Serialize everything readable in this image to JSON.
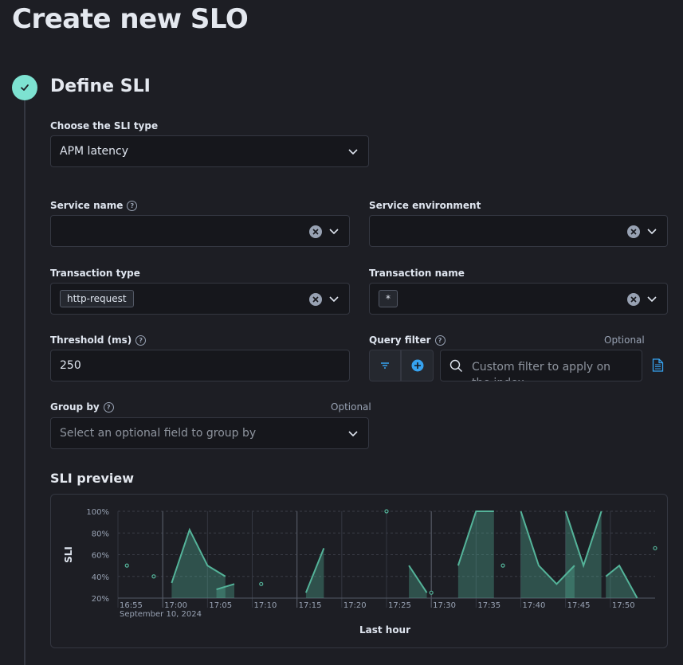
{
  "page": {
    "title": "Create new SLO"
  },
  "step": {
    "title": "Define SLI"
  },
  "sli_type": {
    "label": "Choose the SLI type",
    "value": "APM latency"
  },
  "service_name": {
    "label": "Service name",
    "value": ""
  },
  "service_environment": {
    "label": "Service environment",
    "value": ""
  },
  "transaction_type": {
    "label": "Transaction type",
    "value": "http-request"
  },
  "transaction_name": {
    "label": "Transaction name",
    "value": "*"
  },
  "threshold": {
    "label": "Threshold (ms)",
    "value": "250"
  },
  "query_filter": {
    "label": "Query filter",
    "optional": "Optional",
    "placeholder": "Custom filter to apply on the index"
  },
  "group_by": {
    "label": "Group by",
    "optional": "Optional",
    "placeholder": "Select an optional field to group by"
  },
  "preview": {
    "title": "SLI preview"
  },
  "colors": {
    "accent": "#7de2d1",
    "background": "#1d1e24",
    "field": "#16171c",
    "link": "#36a2ef"
  },
  "chart_data": {
    "type": "area",
    "ylabel": "SLI",
    "xlabel": "Last hour",
    "y_ticks": [
      "100%",
      "80%",
      "60%",
      "40%",
      "20%"
    ],
    "x_ticks": [
      "16:55",
      "17:00",
      "17:05",
      "17:10",
      "17:15",
      "17:20",
      "17:25",
      "17:30",
      "17:35",
      "17:40",
      "17:45",
      "17:50"
    ],
    "x_subtitle": "September 10, 2024",
    "ylim": [
      20,
      100
    ],
    "x_unit": "minutes after 16:55",
    "grid": true,
    "series_color": "#54b399",
    "segments": [
      [
        [
          6,
          34
        ],
        [
          8,
          83
        ],
        [
          10,
          50
        ],
        [
          12,
          40
        ]
      ],
      [
        [
          11,
          28
        ],
        [
          13,
          33
        ]
      ],
      [
        [
          21,
          25
        ],
        [
          23,
          66
        ]
      ],
      [
        [
          32.5,
          50
        ],
        [
          34.5,
          25
        ]
      ],
      [
        [
          38,
          50
        ],
        [
          40,
          100
        ],
        [
          42,
          100
        ]
      ],
      [
        [
          45,
          100
        ],
        [
          47,
          50
        ],
        [
          49,
          33
        ],
        [
          51,
          50
        ]
      ],
      [
        [
          50,
          100
        ],
        [
          52,
          50
        ],
        [
          54,
          100
        ]
      ],
      [
        [
          54.5,
          40
        ],
        [
          56,
          50
        ],
        [
          58,
          20
        ]
      ]
    ],
    "points": [
      [
        1,
        50
      ],
      [
        4,
        40
      ],
      [
        16,
        33
      ],
      [
        30,
        100
      ],
      [
        35,
        25
      ],
      [
        43,
        50
      ],
      [
        60,
        66
      ]
    ]
  }
}
